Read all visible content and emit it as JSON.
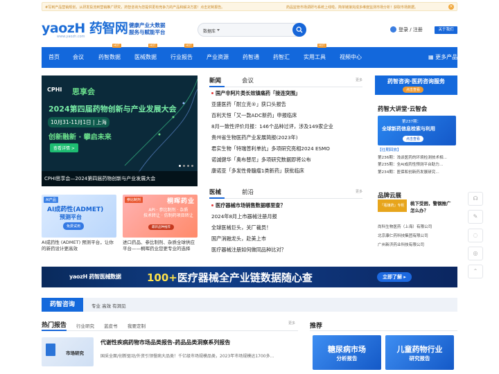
{
  "notice": {
    "left": "#写到产品营销规划，从研发投流到营销推广研究，药智咨询为您提供更有竞争力的产品和解决方案！点击定制报告。",
    "right": "药品监管市场调研与系统上线啦，简单链接完成多维度监测市场分析！获取市场数据。"
  },
  "logo": {
    "main": "yaozH 药智网",
    "url": "www.yaozh.com"
  },
  "slogan": {
    "line1": "健康产业大数据",
    "line2": "服务与赋能平台"
  },
  "search": {
    "scope": "数据库",
    "placeholder": ""
  },
  "login": {
    "text": "登录 / 注册",
    "follow": "关于我们"
  },
  "nav": {
    "items": [
      {
        "label": "首页"
      },
      {
        "label": "会议"
      },
      {
        "label": "药智数据",
        "hot": "HOT"
      },
      {
        "label": "医械数据",
        "hot": "HOT"
      },
      {
        "label": "行业报告",
        "hot": "HOT"
      },
      {
        "label": "产业资源"
      },
      {
        "label": "药智通"
      },
      {
        "label": "药智汇"
      },
      {
        "label": "实用工具",
        "hot": "HOT"
      },
      {
        "label": "视频中心"
      }
    ],
    "more": "更多产品"
  },
  "banner": {
    "brand": "CPHI",
    "brand2": "思享会",
    "headline": "2024第四届药物创新与产业发展大会",
    "date": "10月31-11月1日 | 上海",
    "slogan": "创新融新 · 攀启未来",
    "btn": "查看详情 >",
    "caption": "CPHI思享会—2024第四届药物创新与产业发展大会"
  },
  "cards": [
    {
      "tag": "AI产品",
      "big": "AI成药性(ADMET)",
      "big2": "预测平台",
      "btn": "免费试用",
      "text": "AI成药性 (ADMET) 预测平台，让你的新药设计更高效"
    },
    {
      "tag": "参比制剂",
      "brand": "桐晖药业",
      "l1": "API · 参比制剂 · 杂质",
      "l2": "技术转让 · 仿制药项目转让",
      "btn": "最新品种推荐",
      "text": "进口药品、参比制剂、杂质全球供应平台——桐晖药业您更专业的选择"
    }
  ],
  "news": {
    "tabs": [
      "新闻",
      "会议"
    ],
    "more": "更多",
    "items": [
      {
        "text": "国产非阿片类长效镇痛药「接连突围」",
        "hl": true
      },
      {
        "text": "亚盛医药「耐立克®」获口头报告"
      },
      {
        "text": "百利天恒「又一款ADC新药」申报临床"
      },
      {
        "text": "8月一致性评价月报：146个品种过评，涉及149家企业"
      },
      {
        "text": "贵州省生物医药产业发展简报(2023年)"
      },
      {
        "text": "君实生物「特瑞普利单抗」多项研究亮相2024 ESMO"
      },
      {
        "text": "诺诚健华「奥布替尼」多项研究数据即将公布"
      },
      {
        "text": "康诺亚「多发性骨髓瘤1类新药」获批临床"
      }
    ]
  },
  "device": {
    "tabs": [
      "医械",
      "前沿"
    ],
    "more": "更多",
    "items": [
      {
        "text": "医疗器械市场销售数据哪里查？",
        "hl": true
      },
      {
        "text": "2024年8月上市器械注册月报"
      },
      {
        "text": "全球医械巨头，关厂裁员！"
      },
      {
        "text": "国产消融龙头，赴美上市"
      },
      {
        "text": "医疗器械注册如何做同品种比对？"
      }
    ]
  },
  "right": {
    "ad": {
      "title": "药智咨询·医药咨询服务",
      "btn": "点击查看"
    },
    "lecture_title": "药智大讲堂·云智会",
    "box": {
      "issue": "第237期：",
      "title": "全球新药信息检索与利用",
      "btn": "点击查看"
    },
    "past_label": "【往期回放】",
    "past": [
      "第236期：浅谈医药的环境检测技术相...",
      "第235期：全AI成药性预测平台助力...",
      "第234期：医保和创新药发展研究..."
    ],
    "brand_title": "品牌云展",
    "brand_img": "「瓶嫌药」专柜",
    "brand_txt": [
      "桃下受困，警钢推广",
      "怎么办？"
    ],
    "brands": [
      "尚科生物医药（上海）有限公司",
      "北京康仁药科技集团有限公司",
      "广州新济药业科技有限公司"
    ]
  },
  "wide": {
    "logo": "yaozH 药智医械数据",
    "title_white": "100+",
    "title": "医疗器械全产业链数据随心查",
    "btn": "立即了解 ▸"
  },
  "consult": {
    "head": "药智咨询",
    "sub": "专业 高效 有洞见"
  },
  "hot": {
    "title": "热门报告",
    "tabs": [
      "行业研究",
      "蓝皮书",
      "我要定制"
    ],
    "more": "更多",
    "img_text": "市场研究",
    "report_title": "代谢性疾病药物市场品类报告-药品品类洞察系列报告",
    "report_desc": "国采全面/创新驱动/外资引领慢病大品类！千亿级市场规模品类，2023年市场规模达1700多..."
  },
  "rec": {
    "title": "推荐",
    "cards": [
      {
        "l1": "糖尿病市场",
        "l2": "分析报告"
      },
      {
        "l1": "儿童药物行业",
        "l2": "研究报告"
      }
    ]
  },
  "colors": {
    "primary": "#1368dc",
    "hot": "#f39a2d",
    "red": "#e23c3c"
  }
}
